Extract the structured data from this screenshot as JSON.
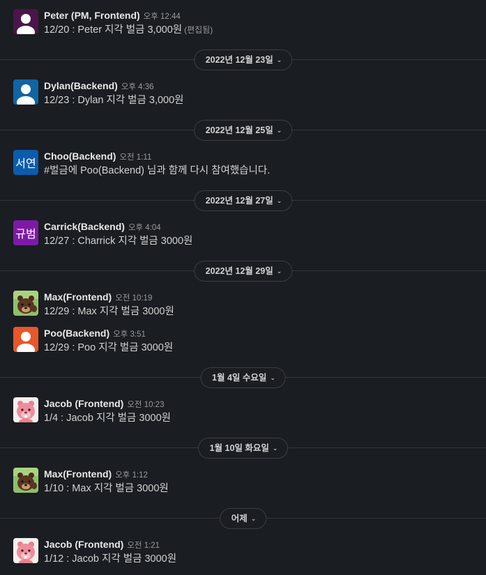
{
  "messages": [
    {
      "user": "Peter (PM, Frontend)",
      "time": "오후 12:44",
      "text": "12/20 : Peter 지각 벌금 3,000원",
      "edited": "(편집됨)",
      "avatar": "person-white",
      "color": "#4a154b"
    },
    {
      "user": "Dylan(Backend)",
      "time": "오후 4:36",
      "text": "12/23 : Dylan 지각 벌금 3,000원",
      "avatar": "person-white",
      "color": "#1264a3"
    },
    {
      "user": "Choo(Backend)",
      "time": "오전 1:11",
      "text": "#벌금에 Poo(Backend) 님과 함께 다시 참여했습니다.",
      "avatar": "initials",
      "initials": "서연",
      "color": "#0b5cad"
    },
    {
      "user": "Carrick(Backend)",
      "time": "오후 4:04",
      "text": "12/27 : Charrick 지각 벌금 3000원",
      "avatar": "initials",
      "initials": "규범",
      "color": "#7d1aa5"
    },
    {
      "user": "Max(Frontend)",
      "time": "오전 10:19",
      "text": "12/29 : Max 지각 벌금 3000원",
      "avatar": "bear-brown"
    },
    {
      "user": "Poo(Backend)",
      "time": "오후 3:51",
      "text": "12/29 : Poo 지각 벌금 3000원",
      "avatar": "person-white",
      "color": "#e8562a"
    },
    {
      "user": "Jacob (Frontend)",
      "time": "오전 10:23",
      "text": "1/4 : Jacob 지각 벌금 3000원",
      "avatar": "beaver-pink"
    },
    {
      "user": "Max(Frontend)",
      "time": "오후 1:12",
      "text": "1/10 : Max 지각 벌금 3000원",
      "avatar": "bear-brown"
    },
    {
      "user": "Jacob (Frontend)",
      "time": "오전 1:21",
      "text": "1/12 : Jacob 지각 벌금 3000원",
      "avatar": "beaver-pink"
    }
  ],
  "dividers": [
    {
      "label": "2022년 12월 23일"
    },
    {
      "label": "2022년 12월 25일"
    },
    {
      "label": "2022년 12월 27일"
    },
    {
      "label": "2022년 12월 29일"
    },
    {
      "label": "1월 4일 수요일"
    },
    {
      "label": "1월 10일 화요일"
    },
    {
      "label": "어제"
    }
  ],
  "icons": {
    "chevron": "chevron-down-icon"
  }
}
